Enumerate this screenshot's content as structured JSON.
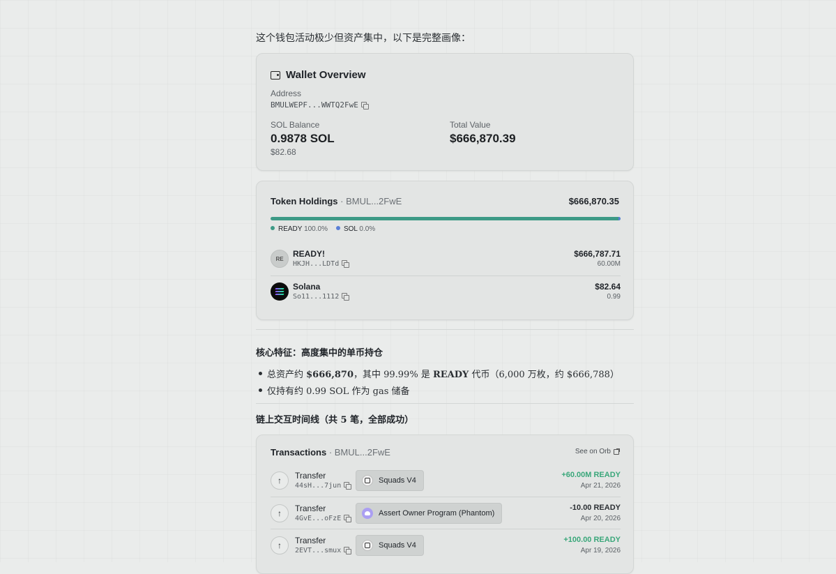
{
  "intro": "这个钱包活动极少但资产集中，以下是完整画像：",
  "wallet": {
    "title": "Wallet Overview",
    "address_label": "Address",
    "address": "BMULWEPF...WWTQ2FwE",
    "sol_label": "SOL Balance",
    "sol_value": "0.9878 SOL",
    "sol_usd": "$82.68",
    "total_label": "Total Value",
    "total_value": "$666,870.39"
  },
  "holdings": {
    "title": "Token Holdings",
    "subtitle": " · BMUL...2FwE",
    "total": "$666,870.35",
    "legend": [
      {
        "name": "READY",
        "pct": "100.0%",
        "color": "#3d9a86"
      },
      {
        "name": "SOL",
        "pct": "0.0%",
        "color": "#5a7fd6"
      }
    ],
    "tokens": [
      {
        "avatar": "RE",
        "name": "READY!",
        "address": "HKJH...LDTd",
        "value": "$666,787.71",
        "amount": "60.00M"
      },
      {
        "avatar": "",
        "name": "Solana",
        "address": "So11...1112",
        "value": "$82.64",
        "amount": "0.99"
      }
    ]
  },
  "features": {
    "heading": "核心特征：高度集中的单币持仓",
    "bullet1": {
      "a": "总资产约 ",
      "b": "$666,870",
      "c": "，其中 99.99% 是 ",
      "d": "READY",
      "e": " 代币（6,000 万枚，约 $666,788）"
    },
    "bullet2": "仅持有约 0.99 SOL 作为 gas 储备"
  },
  "timeline": {
    "heading_a": "链上交互时间线（共 ",
    "heading_b": "5",
    "heading_c": " 笔，全部成功）"
  },
  "transactions": {
    "title": "Transactions",
    "subtitle": " · BMUL...2FwE",
    "orb_label": "See on Orb",
    "rows": [
      {
        "type": "Transfer",
        "sig": "44sH...7jun",
        "program": "Squads V4",
        "icon": "squads",
        "amount": "+60.00M READY",
        "dir": "pos",
        "date": "Apr 21, 2026"
      },
      {
        "type": "Transfer",
        "sig": "4GvE...oFzE",
        "program": "Assert Owner Program (Phantom)",
        "icon": "phantom",
        "amount": "-10.00 READY",
        "dir": "neg",
        "date": "Apr 20, 2026"
      },
      {
        "type": "Transfer",
        "sig": "2EVT...smux",
        "program": "Squads V4",
        "icon": "squads",
        "amount": "+100.00 READY",
        "dir": "pos",
        "date": "Apr 19, 2026"
      }
    ]
  }
}
